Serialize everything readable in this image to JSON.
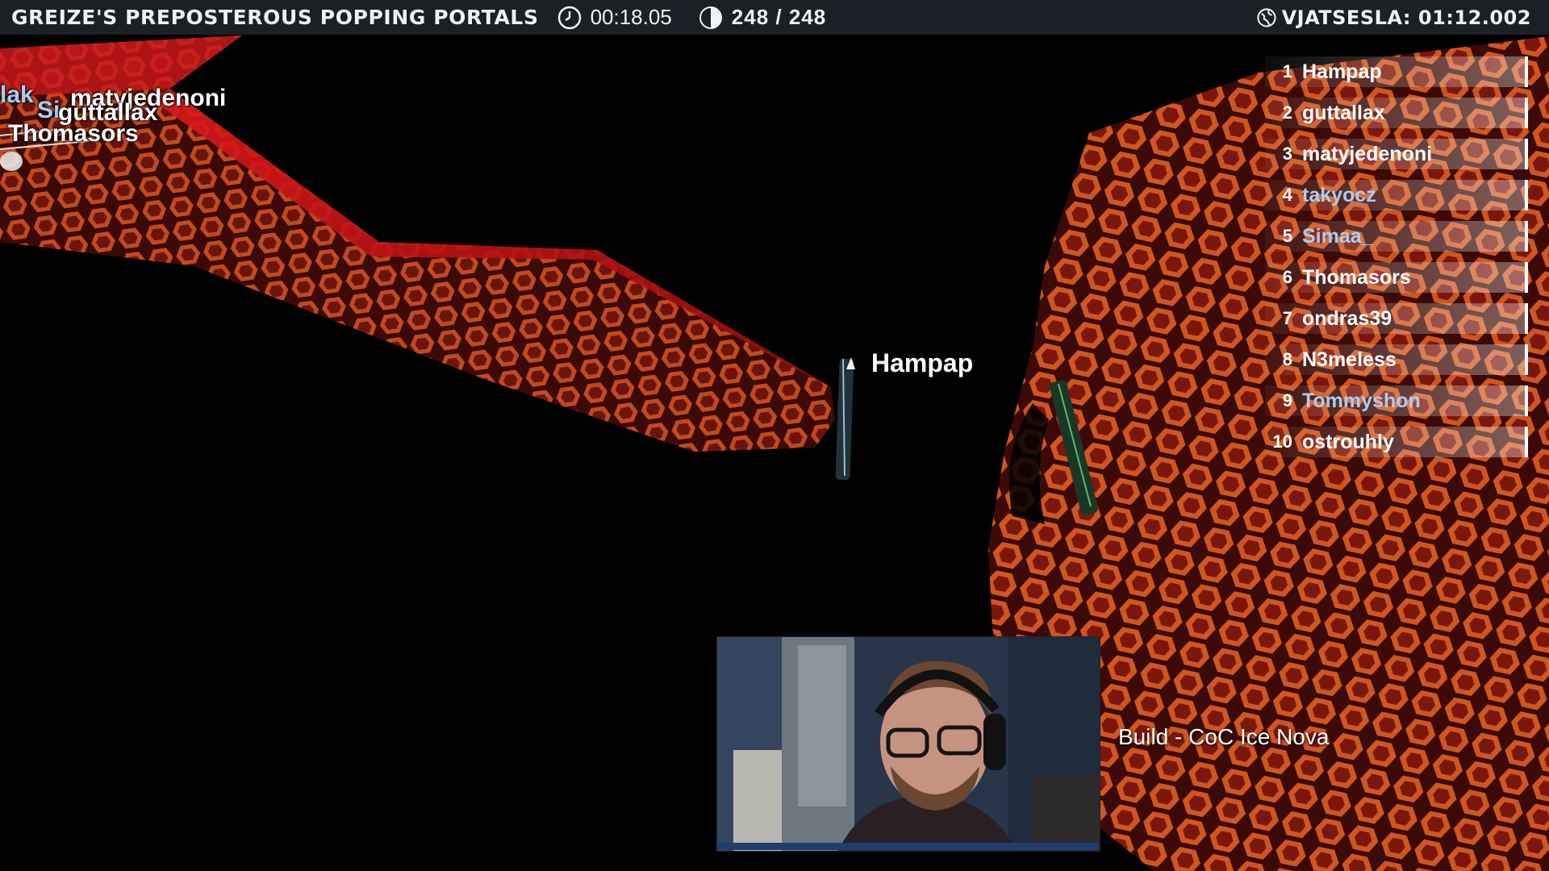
{
  "hud": {
    "title": "Greize's Preposterous Popping Portals",
    "timer": "00:18.05",
    "count": "248 / 248",
    "record": "VJATSESLA: 01:12.002",
    "timer_icon": "clock-icon",
    "count_icon": "half-circle-icon",
    "record_icon": "globe-icon"
  },
  "leaderboard": [
    {
      "rank": "1",
      "name": "Hampap",
      "friend": false
    },
    {
      "rank": "2",
      "name": "guttallax",
      "friend": false
    },
    {
      "rank": "3",
      "name": "matyjedenoni",
      "friend": false
    },
    {
      "rank": "4",
      "name": "takyocz",
      "friend": true
    },
    {
      "rank": "5",
      "name": "Simaa_",
      "friend": true
    },
    {
      "rank": "6",
      "name": "Thomasors",
      "friend": false
    },
    {
      "rank": "7",
      "name": "ondras39",
      "friend": false
    },
    {
      "rank": "8",
      "name": "N3meless",
      "friend": false
    },
    {
      "rank": "9",
      "name": "Tommyshon",
      "friend": true
    },
    {
      "rank": "10",
      "name": "ostrouhly",
      "friend": false
    }
  ],
  "player_tags": {
    "hampap": "Hampap",
    "matyjedenoni": "matyjedenoni",
    "guttallax": "guttallax",
    "thomasors": "Thomasors",
    "lak_fragment": "lak",
    "si_fragment": "Si"
  },
  "overlay": {
    "build_text": "Build - CoC Ice Nova"
  },
  "colors": {
    "hud_bg": "#1b1f26",
    "hex_floor": "#c84a1c",
    "hex_dark": "#3a0806",
    "friend_name": "#a9cdf2"
  }
}
